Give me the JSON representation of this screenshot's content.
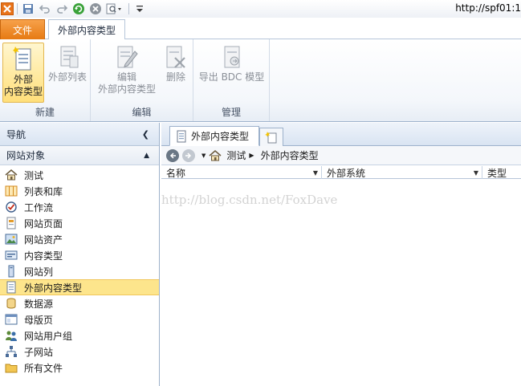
{
  "window": {
    "title": "http://spf01:1"
  },
  "ribbon": {
    "tabs": {
      "file": "文件",
      "external_content_type": "外部内容类型"
    },
    "groups": {
      "new": {
        "label": "新建",
        "buttons": {
          "ect": "外部\n内容类型",
          "ext_list": "外部列表"
        }
      },
      "edit": {
        "label": "编辑",
        "buttons": {
          "edit_ect": "编辑\n外部内容类型",
          "delete": "删除"
        }
      },
      "manage": {
        "label": "管理",
        "buttons": {
          "export_bdc": "导出 BDC 模型"
        }
      }
    }
  },
  "nav": {
    "title": "导航",
    "section_title": "网站对象",
    "items": [
      {
        "label": "测试",
        "icon": "home-icon"
      },
      {
        "label": "列表和库",
        "icon": "lists-icon"
      },
      {
        "label": "工作流",
        "icon": "workflow-icon"
      },
      {
        "label": "网站页面",
        "icon": "site-pages-icon"
      },
      {
        "label": "网站资产",
        "icon": "site-assets-icon"
      },
      {
        "label": "内容类型",
        "icon": "content-types-icon"
      },
      {
        "label": "网站列",
        "icon": "site-columns-icon"
      },
      {
        "label": "外部内容类型",
        "icon": "external-content-types-icon",
        "selected": true
      },
      {
        "label": "数据源",
        "icon": "data-sources-icon"
      },
      {
        "label": "母版页",
        "icon": "master-pages-icon"
      },
      {
        "label": "网站用户组",
        "icon": "site-groups-icon"
      },
      {
        "label": "子网站",
        "icon": "subsites-icon"
      },
      {
        "label": "所有文件",
        "icon": "all-files-icon"
      }
    ]
  },
  "document": {
    "tab_label": "外部内容类型",
    "breadcrumb": {
      "site": "测试",
      "page": "外部内容类型"
    },
    "columns": [
      "名称",
      "外部系统",
      "类型"
    ]
  },
  "watermark": "http://blog.csdn.net/FoxDave",
  "colors": {
    "accent": "#e67a13",
    "selection": "#fde58c"
  }
}
